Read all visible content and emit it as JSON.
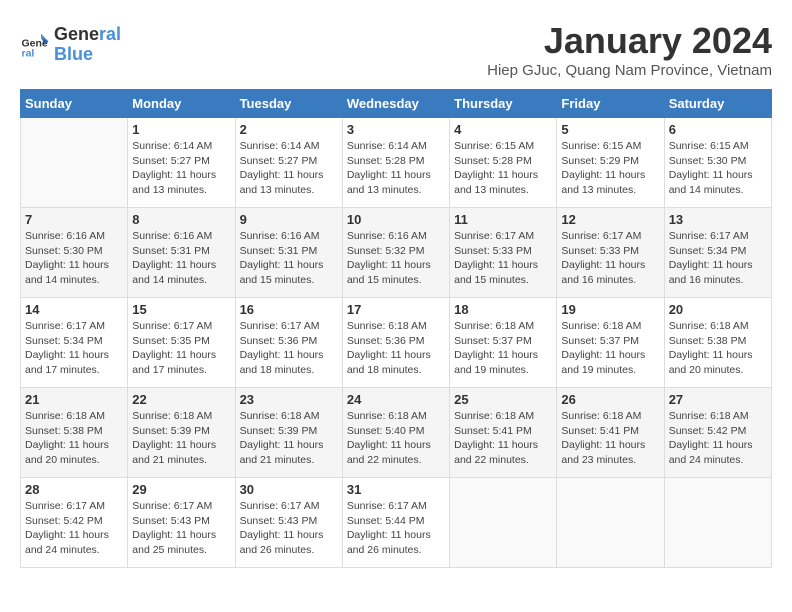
{
  "header": {
    "title": "January 2024",
    "subtitle": "Hiep GJuc, Quang Nam Province, Vietnam"
  },
  "logo": {
    "line1": "General",
    "line2": "Blue"
  },
  "days_of_week": [
    "Sunday",
    "Monday",
    "Tuesday",
    "Wednesday",
    "Thursday",
    "Friday",
    "Saturday"
  ],
  "weeks": [
    [
      {
        "day": "",
        "detail": ""
      },
      {
        "day": "1",
        "detail": "Sunrise: 6:14 AM\nSunset: 5:27 PM\nDaylight: 11 hours\nand 13 minutes."
      },
      {
        "day": "2",
        "detail": "Sunrise: 6:14 AM\nSunset: 5:27 PM\nDaylight: 11 hours\nand 13 minutes."
      },
      {
        "day": "3",
        "detail": "Sunrise: 6:14 AM\nSunset: 5:28 PM\nDaylight: 11 hours\nand 13 minutes."
      },
      {
        "day": "4",
        "detail": "Sunrise: 6:15 AM\nSunset: 5:28 PM\nDaylight: 11 hours\nand 13 minutes."
      },
      {
        "day": "5",
        "detail": "Sunrise: 6:15 AM\nSunset: 5:29 PM\nDaylight: 11 hours\nand 13 minutes."
      },
      {
        "day": "6",
        "detail": "Sunrise: 6:15 AM\nSunset: 5:30 PM\nDaylight: 11 hours\nand 14 minutes."
      }
    ],
    [
      {
        "day": "7",
        "detail": "Sunrise: 6:16 AM\nSunset: 5:30 PM\nDaylight: 11 hours\nand 14 minutes."
      },
      {
        "day": "8",
        "detail": "Sunrise: 6:16 AM\nSunset: 5:31 PM\nDaylight: 11 hours\nand 14 minutes."
      },
      {
        "day": "9",
        "detail": "Sunrise: 6:16 AM\nSunset: 5:31 PM\nDaylight: 11 hours\nand 15 minutes."
      },
      {
        "day": "10",
        "detail": "Sunrise: 6:16 AM\nSunset: 5:32 PM\nDaylight: 11 hours\nand 15 minutes."
      },
      {
        "day": "11",
        "detail": "Sunrise: 6:17 AM\nSunset: 5:33 PM\nDaylight: 11 hours\nand 15 minutes."
      },
      {
        "day": "12",
        "detail": "Sunrise: 6:17 AM\nSunset: 5:33 PM\nDaylight: 11 hours\nand 16 minutes."
      },
      {
        "day": "13",
        "detail": "Sunrise: 6:17 AM\nSunset: 5:34 PM\nDaylight: 11 hours\nand 16 minutes."
      }
    ],
    [
      {
        "day": "14",
        "detail": "Sunrise: 6:17 AM\nSunset: 5:34 PM\nDaylight: 11 hours\nand 17 minutes."
      },
      {
        "day": "15",
        "detail": "Sunrise: 6:17 AM\nSunset: 5:35 PM\nDaylight: 11 hours\nand 17 minutes."
      },
      {
        "day": "16",
        "detail": "Sunrise: 6:17 AM\nSunset: 5:36 PM\nDaylight: 11 hours\nand 18 minutes."
      },
      {
        "day": "17",
        "detail": "Sunrise: 6:18 AM\nSunset: 5:36 PM\nDaylight: 11 hours\nand 18 minutes."
      },
      {
        "day": "18",
        "detail": "Sunrise: 6:18 AM\nSunset: 5:37 PM\nDaylight: 11 hours\nand 19 minutes."
      },
      {
        "day": "19",
        "detail": "Sunrise: 6:18 AM\nSunset: 5:37 PM\nDaylight: 11 hours\nand 19 minutes."
      },
      {
        "day": "20",
        "detail": "Sunrise: 6:18 AM\nSunset: 5:38 PM\nDaylight: 11 hours\nand 20 minutes."
      }
    ],
    [
      {
        "day": "21",
        "detail": "Sunrise: 6:18 AM\nSunset: 5:38 PM\nDaylight: 11 hours\nand 20 minutes."
      },
      {
        "day": "22",
        "detail": "Sunrise: 6:18 AM\nSunset: 5:39 PM\nDaylight: 11 hours\nand 21 minutes."
      },
      {
        "day": "23",
        "detail": "Sunrise: 6:18 AM\nSunset: 5:39 PM\nDaylight: 11 hours\nand 21 minutes."
      },
      {
        "day": "24",
        "detail": "Sunrise: 6:18 AM\nSunset: 5:40 PM\nDaylight: 11 hours\nand 22 minutes."
      },
      {
        "day": "25",
        "detail": "Sunrise: 6:18 AM\nSunset: 5:41 PM\nDaylight: 11 hours\nand 22 minutes."
      },
      {
        "day": "26",
        "detail": "Sunrise: 6:18 AM\nSunset: 5:41 PM\nDaylight: 11 hours\nand 23 minutes."
      },
      {
        "day": "27",
        "detail": "Sunrise: 6:18 AM\nSunset: 5:42 PM\nDaylight: 11 hours\nand 24 minutes."
      }
    ],
    [
      {
        "day": "28",
        "detail": "Sunrise: 6:17 AM\nSunset: 5:42 PM\nDaylight: 11 hours\nand 24 minutes."
      },
      {
        "day": "29",
        "detail": "Sunrise: 6:17 AM\nSunset: 5:43 PM\nDaylight: 11 hours\nand 25 minutes."
      },
      {
        "day": "30",
        "detail": "Sunrise: 6:17 AM\nSunset: 5:43 PM\nDaylight: 11 hours\nand 26 minutes."
      },
      {
        "day": "31",
        "detail": "Sunrise: 6:17 AM\nSunset: 5:44 PM\nDaylight: 11 hours\nand 26 minutes."
      },
      {
        "day": "",
        "detail": ""
      },
      {
        "day": "",
        "detail": ""
      },
      {
        "day": "",
        "detail": ""
      }
    ]
  ]
}
